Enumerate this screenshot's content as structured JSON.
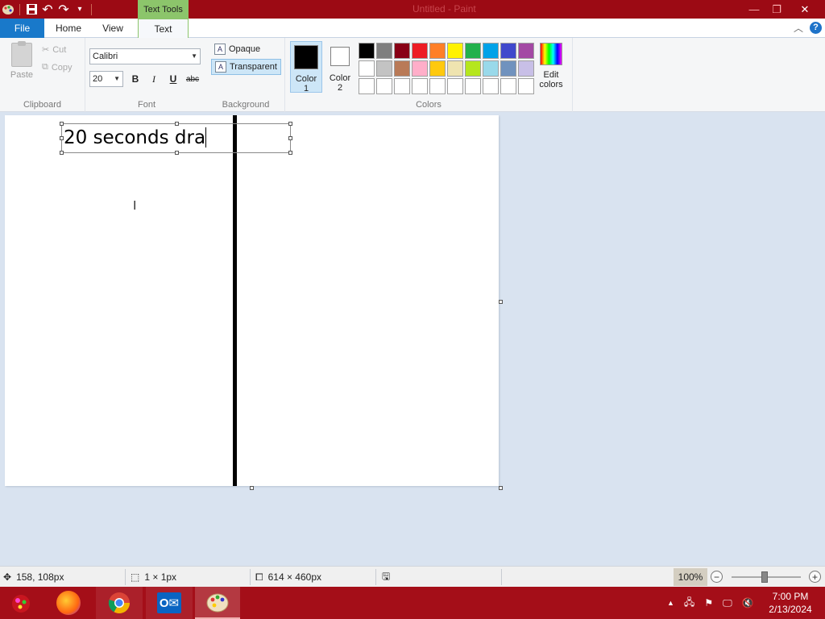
{
  "window": {
    "title": "Untitled - Paint",
    "contextual_tab_title": "Text Tools",
    "minimize": "—",
    "maximize": "❐",
    "close": "✕"
  },
  "qat": {
    "save": "💾",
    "undo": "↶",
    "redo": "↷",
    "customize": "▾"
  },
  "tabs": {
    "file": "File",
    "home": "Home",
    "view": "View",
    "text": "Text"
  },
  "help": {
    "collapse": "︿",
    "help": "?"
  },
  "clipboard": {
    "paste": "Paste",
    "cut": "Cut",
    "copy": "Copy",
    "label": "Clipboard"
  },
  "font": {
    "family": "Calibri",
    "size": "20",
    "bold": "B",
    "italic": "I",
    "underline": "U",
    "strikethrough": "abc",
    "label": "Font"
  },
  "background": {
    "opaque": "Opaque",
    "transparent": "Transparent",
    "label": "Background",
    "selected": "Transparent"
  },
  "colors": {
    "color1_label": "Color 1",
    "color2_label": "Color 2",
    "color1_value": "#000000",
    "color2_value": "#ffffff",
    "edit_label": "Edit colors",
    "label": "Colors",
    "palette": [
      "#000000",
      "#7f7f7f",
      "#880015",
      "#ed1c24",
      "#ff7f27",
      "#fff200",
      "#22b14c",
      "#00a2e8",
      "#3f48cc",
      "#a349a4",
      "#ffffff",
      "#c3c3c3",
      "#b97a57",
      "#ffaec9",
      "#ffc90e",
      "#efe4b0",
      "#b5e61d",
      "#99d9ea",
      "#7092be",
      "#c8bfe7",
      "#ffffff",
      "#ffffff",
      "#ffffff",
      "#ffffff",
      "#ffffff",
      "#ffffff",
      "#ffffff",
      "#ffffff",
      "#ffffff",
      "#ffffff"
    ]
  },
  "canvas": {
    "text": "20 seconds dra"
  },
  "status": {
    "cursor_pos": "158, 108px",
    "selection_size": "1 × 1px",
    "image_size": "614 × 460px",
    "zoom": "100%"
  },
  "taskbar": {
    "time": "7:00 PM",
    "date": "2/13/2024"
  }
}
